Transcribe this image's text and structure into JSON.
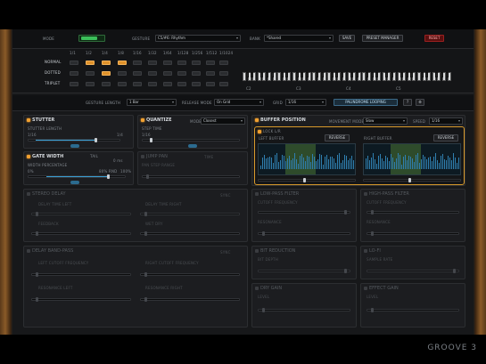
{
  "topbar": {
    "mode_label": "MODE",
    "gesture_label": "GESTURE",
    "gesture_value": "C5/#6: Rhythm",
    "bank_label": "BANK",
    "bank_value": "*Shared",
    "save_label": "SAVE",
    "preset_manager_label": "PRESET MANAGER",
    "reset_label": "RESET"
  },
  "sequencer": {
    "rows": [
      "NORMAL",
      "DOTTED",
      "TRIPLET"
    ],
    "divisions": [
      "1/1",
      "1/2",
      "1/4",
      "1/8",
      "1/16",
      "1/32",
      "1/64",
      "1/128",
      "1/256",
      "1/512",
      "1/1024"
    ],
    "octave_labels": [
      "C2",
      "C3",
      "C4",
      "C5"
    ]
  },
  "controls": {
    "gesture_length_label": "GESTURE LENGTH",
    "gesture_length_value": "1 Bar",
    "release_mode_label": "RELEASE MODE",
    "release_mode_value": "On Grid",
    "grid_label": "GRID",
    "grid_value": "1/16",
    "palindrome_label": "PALINDROME LOOPING",
    "help_label": "?"
  },
  "modules": {
    "stutter": {
      "title": "STUTTER",
      "param": "STUTTER LENGTH",
      "left": "1/16",
      "right": "1/4"
    },
    "quantize": {
      "title": "QUANTIZE",
      "mode_label": "MODE",
      "mode_value": "Closest",
      "param": "STEP TIME",
      "left": "1/16"
    },
    "gate_width": {
      "title": "GATE WIDTH",
      "tail_label": "TAIL",
      "param": "WIDTH PERCENTAGE",
      "left": "0%",
      "mid": "80% RND",
      "right": "100%",
      "small": "0 ms"
    },
    "jump_pan": {
      "title": "JUMP PAN",
      "sub": "TIME",
      "param": "PAN STEP RANGE"
    },
    "buffer_position": {
      "title": "BUFFER POSITION",
      "movement_label": "MOVEMENT MODE",
      "movement_value": "Slow",
      "speed_label": "SPEED",
      "speed_value": "1/16",
      "lock_label": "LOCK L/R",
      "left_buffer": "LEFT BUFFER",
      "right_buffer": "RIGHT BUFFER",
      "reverse": "REVERSE"
    },
    "stereo_delay": {
      "title": "STEREO DELAY",
      "sync": "SYNC",
      "p1": "DELAY TIME LEFT",
      "p2": "DELAY TIME RIGHT",
      "p3": "FEEDBACK",
      "p4": "WET DRY"
    },
    "delay_band_pass": {
      "title": "DELAY BAND-PASS",
      "sync": "SYNC",
      "p1": "LEFT CUTOFF FREQUENCY",
      "p2": "RIGHT CUTOFF FREQUENCY",
      "p3": "RESONANCE LEFT",
      "p4": "RESONANCE RIGHT"
    },
    "low_pass": {
      "title": "LOW-PASS FILTER",
      "p1": "CUTOFF FREQUENCY",
      "p2": "RESONANCE"
    },
    "high_pass": {
      "title": "HIGH-PASS FILTER",
      "p1": "CUTOFF FREQUENCY",
      "p2": "RESONANCE"
    },
    "bit_reduction": {
      "title": "BIT REDUCTION",
      "p1": "BIT DEPTH"
    },
    "lo_fi": {
      "title": "LO-FI",
      "p1": "SAMPLE RATE"
    },
    "dry_gain": {
      "title": "DRY GAIN",
      "p1": "LEVEL"
    },
    "effect_gain": {
      "title": "EFFECT GAIN",
      "p1": "LEVEL"
    }
  },
  "footer": {
    "logo": "GROOVE 3"
  },
  "colors": {
    "accent": "#e0922a",
    "blue": "#3aa0d6",
    "alert": "#9a2020"
  }
}
